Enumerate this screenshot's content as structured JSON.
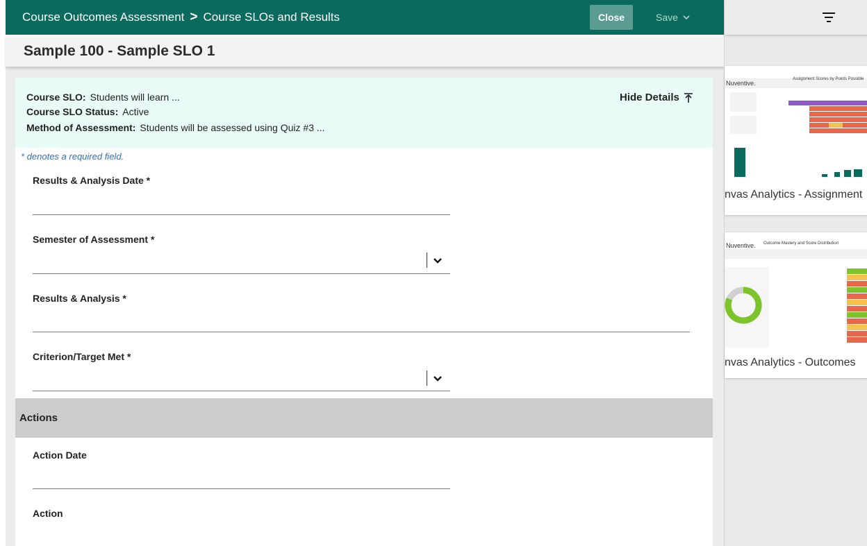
{
  "header": {
    "breadcrumb": [
      "Course Outcomes Assessment",
      "Course SLOs and Results"
    ],
    "breadcrumb_sep": ">",
    "close_label": "Close",
    "save_label": "Save"
  },
  "page_title": "Sample 100 - Sample SLO 1",
  "details": {
    "slo_label": "Course SLO:",
    "slo_value": "Students will learn ...",
    "status_label": "Course SLO Status:",
    "status_value": "Active",
    "method_label": "Method of Assessment:",
    "method_value": "Students will be assessed using Quiz #3 ...",
    "hide_label": "Hide Details"
  },
  "required_note": "* denotes a required field.",
  "fields": {
    "results_date": "Results & Analysis Date *",
    "semester": "Semester of Assessment *",
    "results": "Results & Analysis *",
    "criterion": "Criterion/Target Met *"
  },
  "actions": {
    "title": "Actions",
    "action_date": "Action Date",
    "action": "Action"
  },
  "right_panel": {
    "cards": [
      {
        "title": "nvas Analytics - Assignment",
        "brand": "Nuventive.",
        "caption": "Assignment Scores by Points Possible"
      },
      {
        "title": "nvas Analytics - Outcomes",
        "brand": "Nuventive.",
        "caption": "Outcome Mastery and Score Distribution"
      }
    ]
  },
  "colors": {
    "header_bg": "#0a6a5d",
    "details_bg": "#e9fbf6",
    "link_blue": "#2c6fbf"
  }
}
